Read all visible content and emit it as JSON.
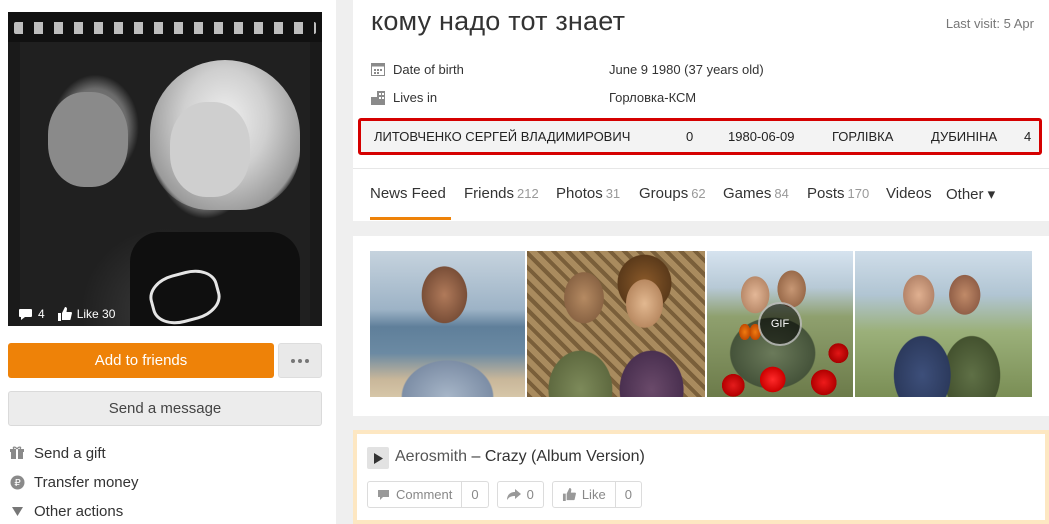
{
  "profile": {
    "name": "кому надо тот знает",
    "last_visit": "Last visit: 5 Apr",
    "info": [
      {
        "icon": "calendar-icon",
        "label": "Date of birth",
        "value": "June 9 1980 (37 years old)"
      },
      {
        "icon": "city-icon",
        "label": "Lives in",
        "value": "Горловка-КСМ"
      }
    ],
    "highlight": {
      "full_name": "ЛИТОВЧЕНКО СЕРГЕЙ ВЛАДИМИРОВИЧ",
      "col1": "0",
      "date": "1980-06-09",
      "city": "ГОРЛІВКА",
      "street": "ДУБИНІНА",
      "col2": "4",
      "border_color": "#d50000"
    }
  },
  "avatar": {
    "comments": "4",
    "likes": "Like 30"
  },
  "sidebar": {
    "add_friend": "Add to friends",
    "send_message": "Send a message",
    "actions": [
      {
        "icon": "gift-icon",
        "label": "Send a gift"
      },
      {
        "icon": "ruble-icon",
        "label": "Transfer money"
      },
      {
        "icon": "triangle-down-icon",
        "label": "Other actions"
      }
    ]
  },
  "tabs": [
    {
      "label": "News Feed",
      "count": ""
    },
    {
      "label": "Friends",
      "count": "212"
    },
    {
      "label": "Photos",
      "count": "31"
    },
    {
      "label": "Groups",
      "count": "62"
    },
    {
      "label": "Games",
      "count": "84"
    },
    {
      "label": "Posts",
      "count": "170"
    },
    {
      "label": "Videos",
      "count": ""
    },
    {
      "label": "Other ▾",
      "count": ""
    }
  ],
  "photos": {
    "gif_label": "GIF"
  },
  "music": {
    "artist": "Aerosmith",
    "dash": " – ",
    "title": "Crazy (Album Version)",
    "comment_label": "Comment",
    "comment_count": "0",
    "share_count": "0",
    "like_label": "Like",
    "like_count": "0"
  },
  "colors": {
    "accent": "#ee8208",
    "music_border": "#fde7c2"
  }
}
